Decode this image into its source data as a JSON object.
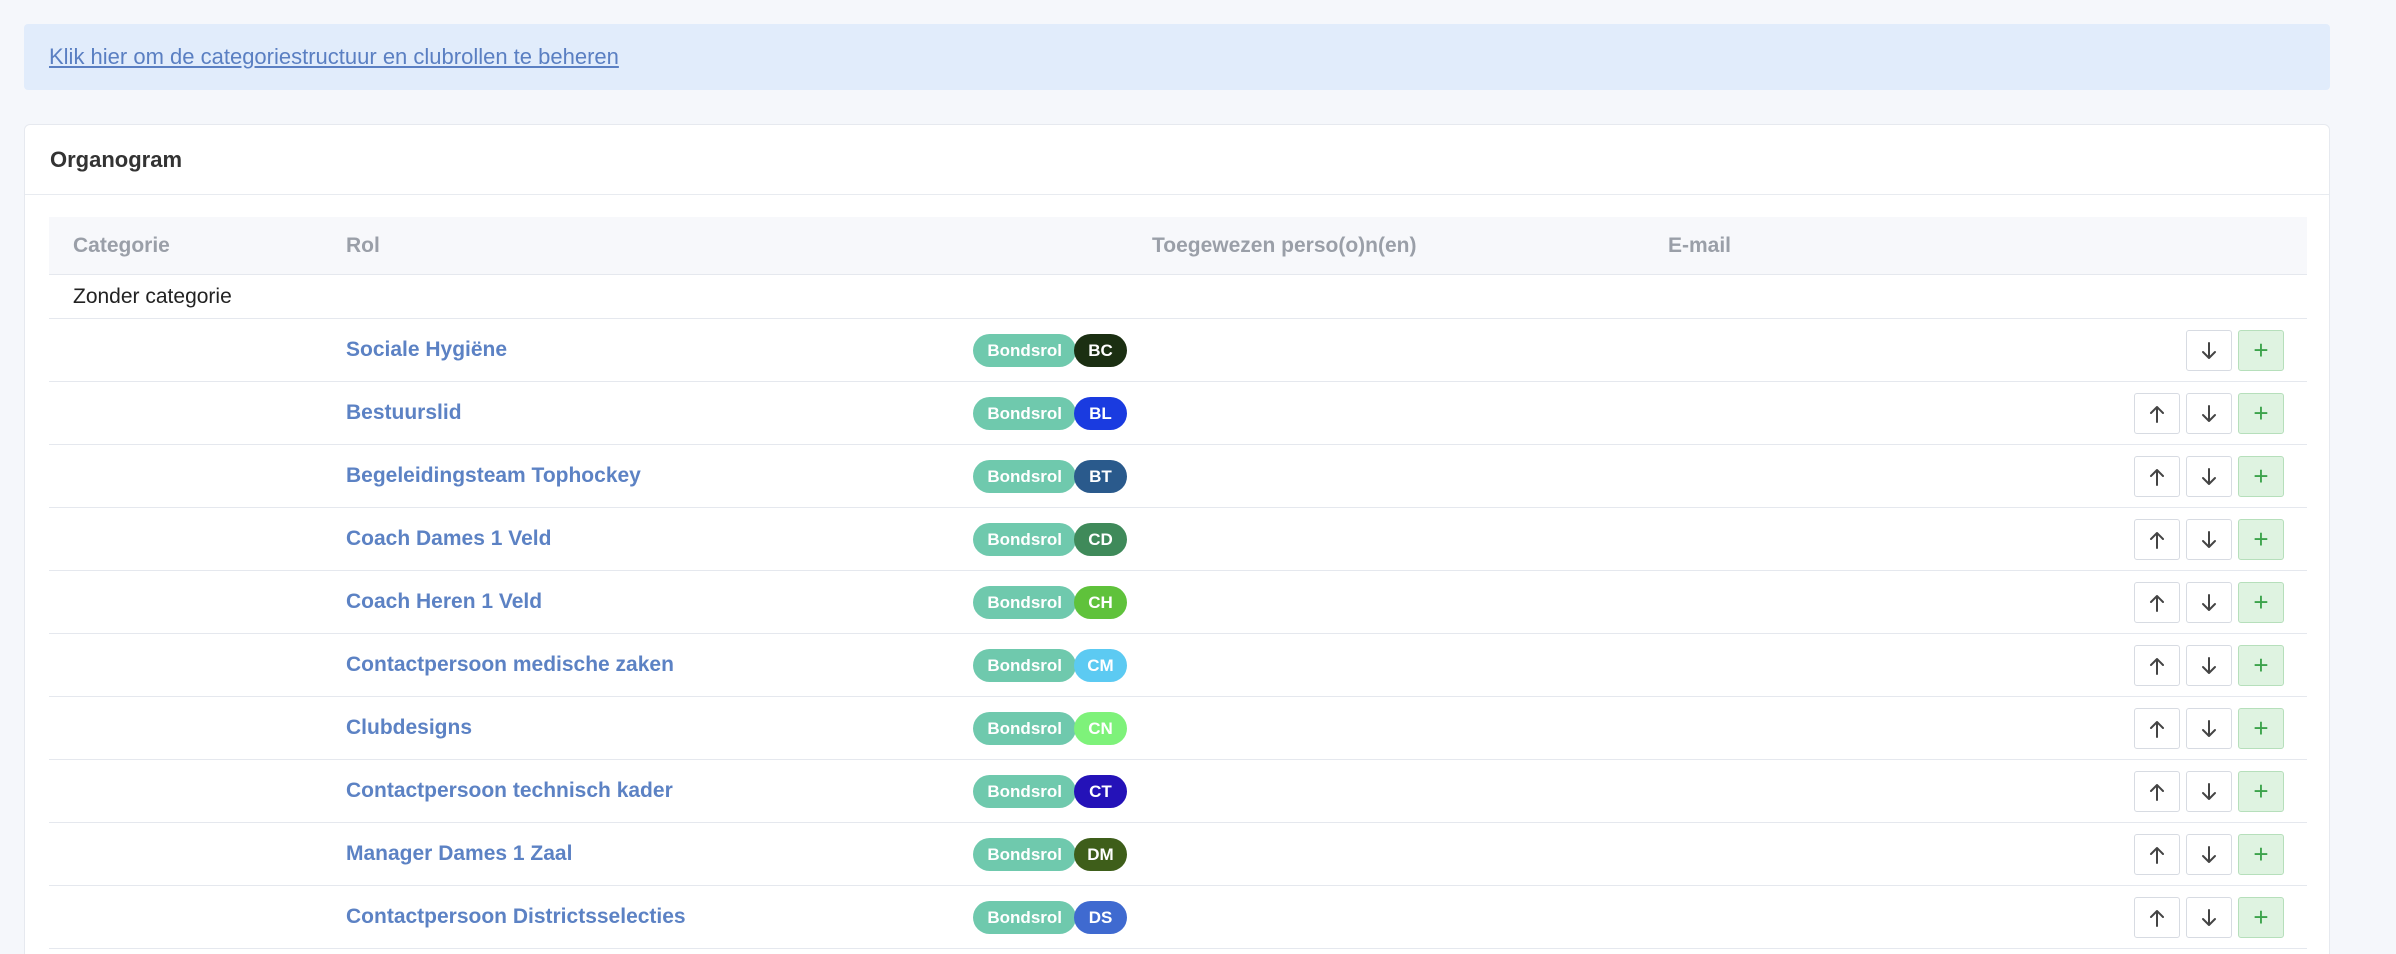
{
  "notice": {
    "link_text": "Klik hier om de categoriestructuur en clubrollen te beheren"
  },
  "card": {
    "title": "Organogram"
  },
  "table": {
    "headers": {
      "category": "Categorie",
      "role": "Rol",
      "assigned": "Toegewezen perso(o)n(en)",
      "email": "E-mail"
    },
    "category_label": "Zonder categorie",
    "rows": [
      {
        "name": "Sociale Hygiëne",
        "badge": "Bondsrol",
        "abbr": "BC",
        "abbr_color": "#1b2f12"
      },
      {
        "name": "Bestuurslid",
        "badge": "Bondsrol",
        "abbr": "BL",
        "abbr_color": "#1a3be0"
      },
      {
        "name": "Begeleidingsteam Tophockey",
        "badge": "Bondsrol",
        "abbr": "BT",
        "abbr_color": "#2a5a8c"
      },
      {
        "name": "Coach Dames 1 Veld",
        "badge": "Bondsrol",
        "abbr": "CD",
        "abbr_color": "#3f8a5a"
      },
      {
        "name": "Coach Heren 1 Veld",
        "badge": "Bondsrol",
        "abbr": "CH",
        "abbr_color": "#5fc23b"
      },
      {
        "name": "Contactpersoon medische zaken",
        "badge": "Bondsrol",
        "abbr": "CM",
        "abbr_color": "#5ccaf2"
      },
      {
        "name": "Clubdesigns",
        "badge": "Bondsrol",
        "abbr": "CN",
        "abbr_color": "#7ef27a"
      },
      {
        "name": "Contactpersoon technisch kader",
        "badge": "Bondsrol",
        "abbr": "CT",
        "abbr_color": "#2412b8"
      },
      {
        "name": "Manager Dames 1 Zaal",
        "badge": "Bondsrol",
        "abbr": "DM",
        "abbr_color": "#3e5e1a"
      },
      {
        "name": "Contactpersoon Districtsselecties",
        "badge": "Bondsrol",
        "abbr": "DS",
        "abbr_color": "#3f6ad0"
      }
    ],
    "actions": {
      "up_icon": "arrow-up-icon",
      "down_icon": "arrow-down-icon",
      "add_icon": "plus-icon",
      "add_label": "+"
    }
  }
}
